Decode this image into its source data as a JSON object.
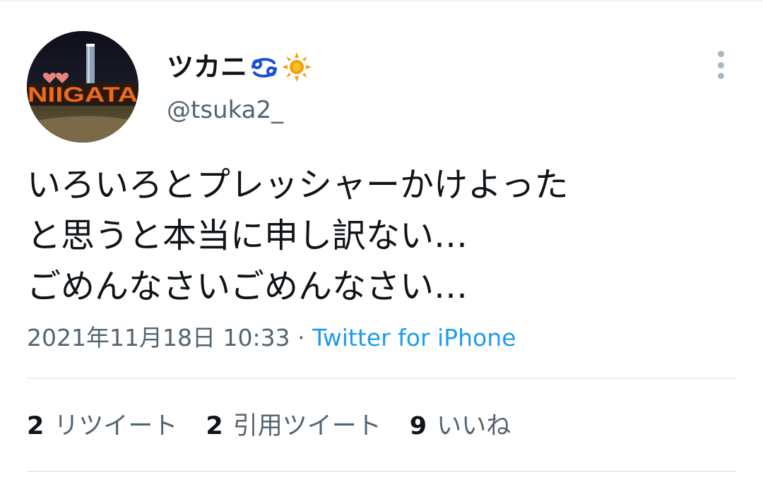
{
  "tweet": {
    "display_name": "ツカニ",
    "name_emojis": [
      "cancer-zodiac-icon",
      "sun-icon"
    ],
    "handle": "@tsuka2_",
    "avatar_sign_text": "NIIGATA",
    "text_lines": [
      "いろいろとプレッシャーかけよった",
      "と思うと本当に申し訳ない…",
      "ごめんなさいごめんなさい…"
    ],
    "timestamp": "2021年11月18日 10:33",
    "separator": "·",
    "source": "Twitter for iPhone",
    "stats": [
      {
        "count": "2",
        "label": "リツイート"
      },
      {
        "count": "2",
        "label": "引用ツイート"
      },
      {
        "count": "9",
        "label": "いいね"
      }
    ]
  },
  "colors": {
    "text": "#0f1419",
    "secondary_text": "#536471",
    "link": "#1d9bf0",
    "divider": "#e6ecf0",
    "cancer_icon": "#1d4ed8",
    "sun_icon": "#f59e0b"
  }
}
